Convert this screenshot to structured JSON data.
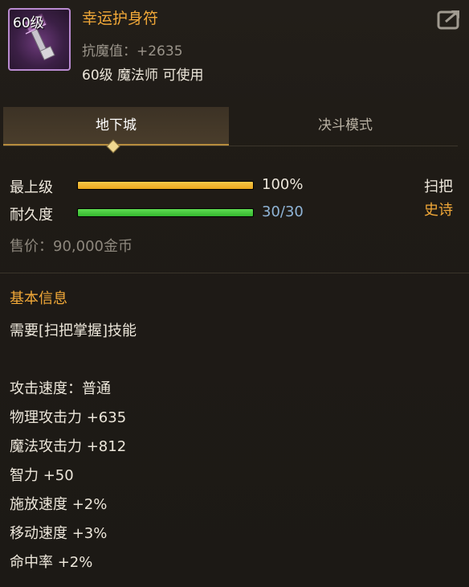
{
  "item": {
    "level_badge": "60级",
    "name": "幸运护身符",
    "stat_line": "抗魔值：+2635",
    "requirement": "60级 魔法师 可使用",
    "type": "扫把",
    "rarity": "史诗",
    "rarity_color": "#f1a838"
  },
  "header": {
    "share_icon": "share-icon"
  },
  "tabs": [
    {
      "label": "地下城",
      "active": true
    },
    {
      "label": "决斗模式",
      "active": false
    }
  ],
  "bars": {
    "level": {
      "label": "最上级",
      "value_text": "100%",
      "fraction": 1.0,
      "color": "#e8a51c"
    },
    "durability": {
      "label": "耐久度",
      "value_text": "30/30",
      "fraction": 1.0,
      "color": "#34b82e"
    }
  },
  "price": "售价：90,000金币",
  "basic_info": {
    "title": "基本信息",
    "skill_req": "需要[扫把掌握]技能",
    "attributes": [
      "攻击速度：普通",
      "物理攻击力 +635",
      "魔法攻击力 +812",
      "智力 +50",
      "施放速度 +2%",
      "移动速度 +3%",
      "命中率 +2%"
    ]
  }
}
